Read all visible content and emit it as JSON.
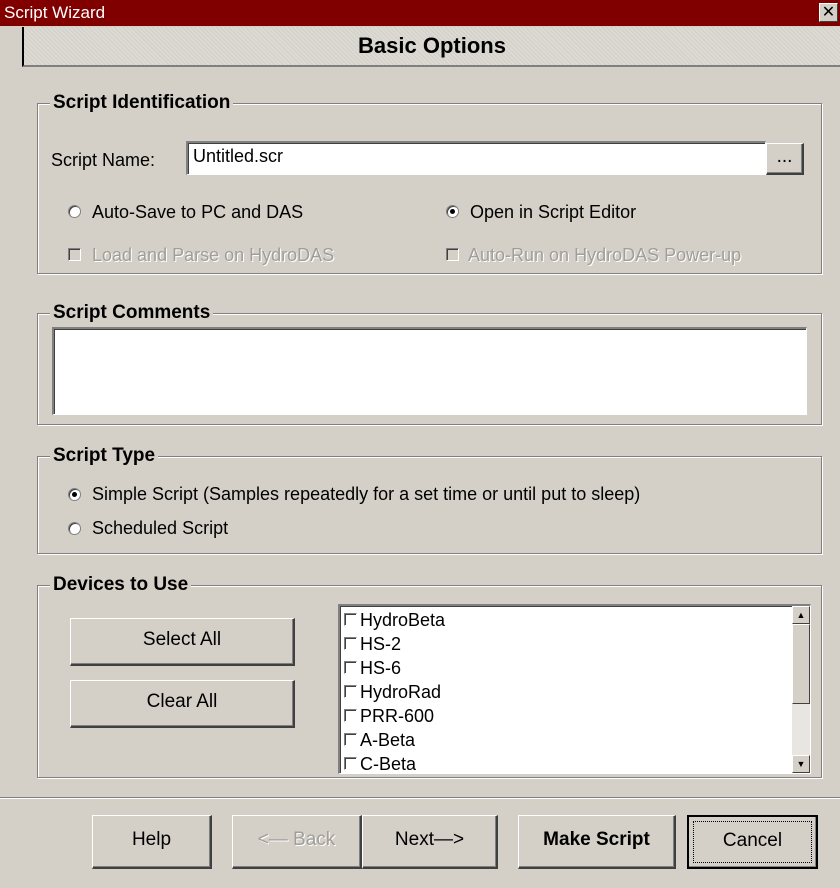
{
  "window": {
    "title": "Script Wizard",
    "close_glyph": "✕"
  },
  "header": {
    "title": "Basic Options"
  },
  "identification": {
    "legend": "Script Identification",
    "name_label": "Script Name:",
    "name_value": "Untitled.scr",
    "browse_label": "...",
    "auto_save_label": "Auto-Save to PC and DAS",
    "open_editor_label": "Open in Script Editor",
    "load_parse_label": "Load and Parse on HydroDAS",
    "auto_run_label": "Auto-Run on HydroDAS Power-up"
  },
  "comments": {
    "legend": "Script Comments",
    "value": ""
  },
  "script_type": {
    "legend": "Script Type",
    "simple_label": "Simple Script (Samples repeatedly for a set time or until put to sleep)",
    "scheduled_label": "Scheduled Script"
  },
  "devices": {
    "legend": "Devices to Use",
    "select_all_label": "Select All",
    "clear_all_label": "Clear All",
    "items": [
      "HydroBeta",
      "HS-2",
      "HS-6",
      "HydroRad",
      "PRR-600",
      "A-Beta",
      "C-Beta"
    ]
  },
  "footer": {
    "help_label": "Help",
    "back_label": "<— Back",
    "next_label": "Next—>",
    "make_script_label": "Make Script",
    "cancel_label": "Cancel"
  },
  "colors": {
    "titlebar": "#800000",
    "face": "#d4d0c8"
  }
}
